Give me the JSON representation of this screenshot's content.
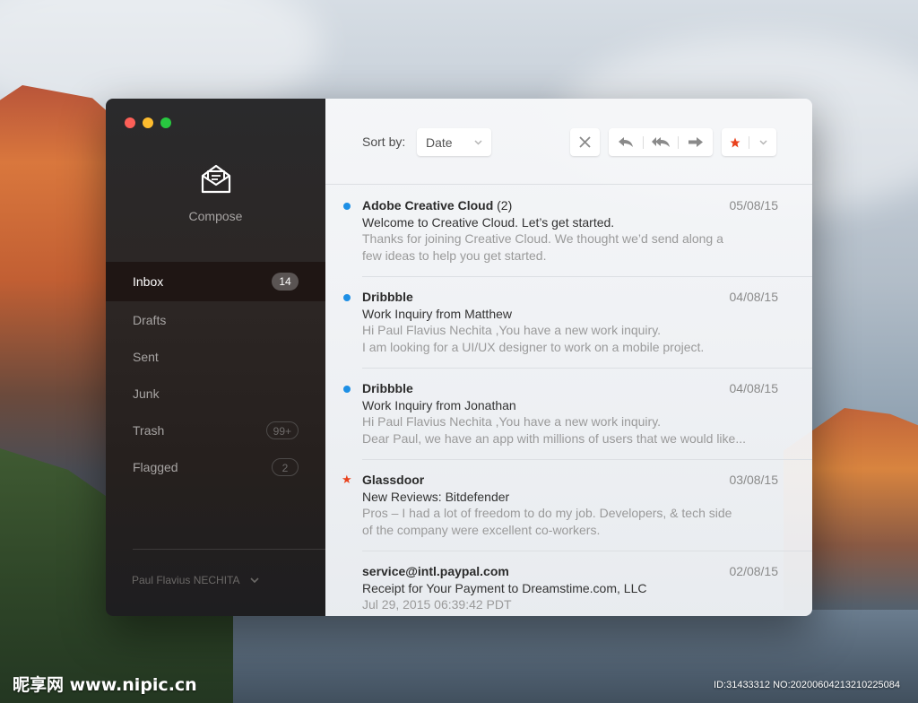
{
  "window": {
    "compose_label": "Compose"
  },
  "sidebar": {
    "items": [
      {
        "label": "Inbox",
        "badge": "14"
      },
      {
        "label": "Drafts",
        "badge": ""
      },
      {
        "label": "Sent",
        "badge": ""
      },
      {
        "label": "Junk",
        "badge": ""
      },
      {
        "label": "Trash",
        "badge": "99+"
      },
      {
        "label": "Flagged",
        "badge": "2"
      }
    ],
    "account_name": "Paul Flavius NECHITA"
  },
  "toolbar": {
    "sort_label": "Sort by:",
    "sort_value": "Date"
  },
  "messages": [
    {
      "sender": "Adobe Creative Cloud",
      "count": "(2)",
      "date": "05/08/15",
      "subject": "Welcome to Creative Cloud. Let’s get started.",
      "preview1": "Thanks for joining Creative Cloud. We thought we’d send along a",
      "preview2": "few ideas to help you get started.",
      "marker": "unread"
    },
    {
      "sender": "Dribbble",
      "count": "",
      "date": "04/08/15",
      "subject": "Work Inquiry from Matthew",
      "preview1": "Hi Paul Flavius Nechita ,You have a new work inquiry.",
      "preview2": "I am looking for a UI/UX designer to work on a mobile project.",
      "marker": "unread"
    },
    {
      "sender": "Dribbble",
      "count": "",
      "date": "04/08/15",
      "subject": "Work Inquiry from Jonathan",
      "preview1": "Hi Paul Flavius Nechita ,You have a new work inquiry.",
      "preview2": "Dear Paul, we have an app with millions of users that we would like...",
      "marker": "unread"
    },
    {
      "sender": "Glassdoor",
      "count": "",
      "date": "03/08/15",
      "subject": "New Reviews: Bitdefender",
      "preview1": "Pros – I had a lot of freedom to do my job. Developers, & tech side",
      "preview2": "of the company were excellent co-workers.",
      "marker": "starred"
    },
    {
      "sender": "service@intl.paypal.com",
      "count": "",
      "date": "02/08/15",
      "subject": "Receipt for Your Payment to Dreamstime.com, LLC",
      "preview1": "Jul 29, 2015 06:39:42 PDT",
      "preview2": "",
      "marker": "none"
    }
  ],
  "watermark": {
    "left": "昵享网 www.nipic.cn",
    "right": "ID:31433312 NO:20200604213210225084"
  },
  "colors": {
    "unread_dot": "#1d8fe5",
    "star": "#e9411c",
    "sidebar_bg": "#2a2a2c",
    "active_item_bg": "#1f1614"
  }
}
